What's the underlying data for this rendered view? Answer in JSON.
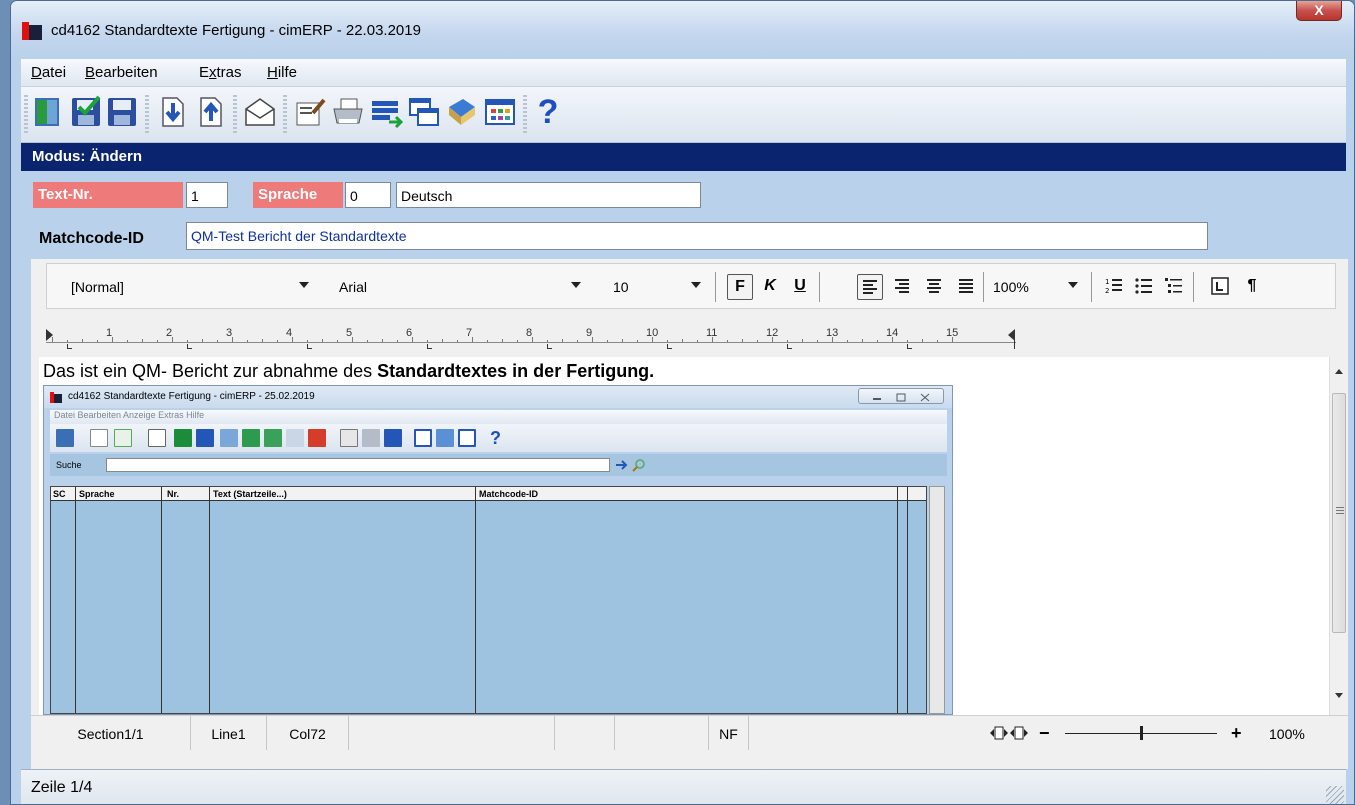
{
  "window": {
    "title": "cd4162 Standardtexte Fertigung - cimERP - 22.03.2019",
    "close_label": "X"
  },
  "menu": [
    {
      "label": "Datei",
      "underline": "D"
    },
    {
      "label": "Bearbeiten",
      "underline": "B"
    },
    {
      "label": "Extras",
      "underline": "x"
    },
    {
      "label": "Hilfe",
      "underline": "H"
    }
  ],
  "toolbar": {
    "icons": [
      "exit-door-icon",
      "save-close-icon",
      "save-icon",
      "import-down-icon",
      "export-up-icon",
      "mail-icon",
      "edit-properties-icon",
      "print-icon",
      "transfer-icon",
      "copy-windows-icon",
      "book-icon",
      "grid-icon",
      "help-icon"
    ],
    "help_glyph": "?"
  },
  "mode": {
    "text": "Modus: Ändern"
  },
  "form": {
    "text_nr_label": "Text-Nr.",
    "text_nr_value": "1",
    "sprache_label": "Sprache",
    "sprache_code": "0",
    "sprache_name": "Deutsch",
    "matchcode_label": "Matchcode-ID",
    "matchcode_value": "QM-Test Bericht der Standardtexte"
  },
  "format": {
    "style": "[Normal]",
    "font": "Arial",
    "size": "10",
    "bold": "F",
    "italic": "K",
    "underline": "U",
    "zoom": "100%",
    "para": "¶"
  },
  "ruler": {
    "numbers": [
      "1",
      "2",
      "3",
      "4",
      "5",
      "6",
      "7",
      "8",
      "9",
      "10",
      "11",
      "12",
      "13",
      "14",
      "15"
    ]
  },
  "document": {
    "line_plain": "Das ist ein QM- Bericht zur abnahme des ",
    "line_bold": "Standardtextes in der Fertigung."
  },
  "embedded": {
    "title": "cd4162 Standardtexte Fertigung - cimERP - 25.02.2019",
    "menu": "Datei   Bearbeiten   Anzeige   Extras   Hilfe",
    "search_label": "Suche",
    "columns": [
      "SC",
      "Sprache",
      "Nr.",
      "Text (Startzeile...)",
      "Matchcode-ID"
    ]
  },
  "editor_status": {
    "section": "Section1/1",
    "line": "Line1",
    "col": "Col72",
    "nf": "NF",
    "zoom_minus": "−",
    "zoom_plus": "+",
    "zoom": "100%",
    "zoom_level": 0.5
  },
  "status": {
    "zeile": "Zeile 1/4"
  },
  "colors": {
    "mode_bar": "#0a2470",
    "label_red": "#ef7a7a",
    "window_bg": "#b9d1ea"
  }
}
